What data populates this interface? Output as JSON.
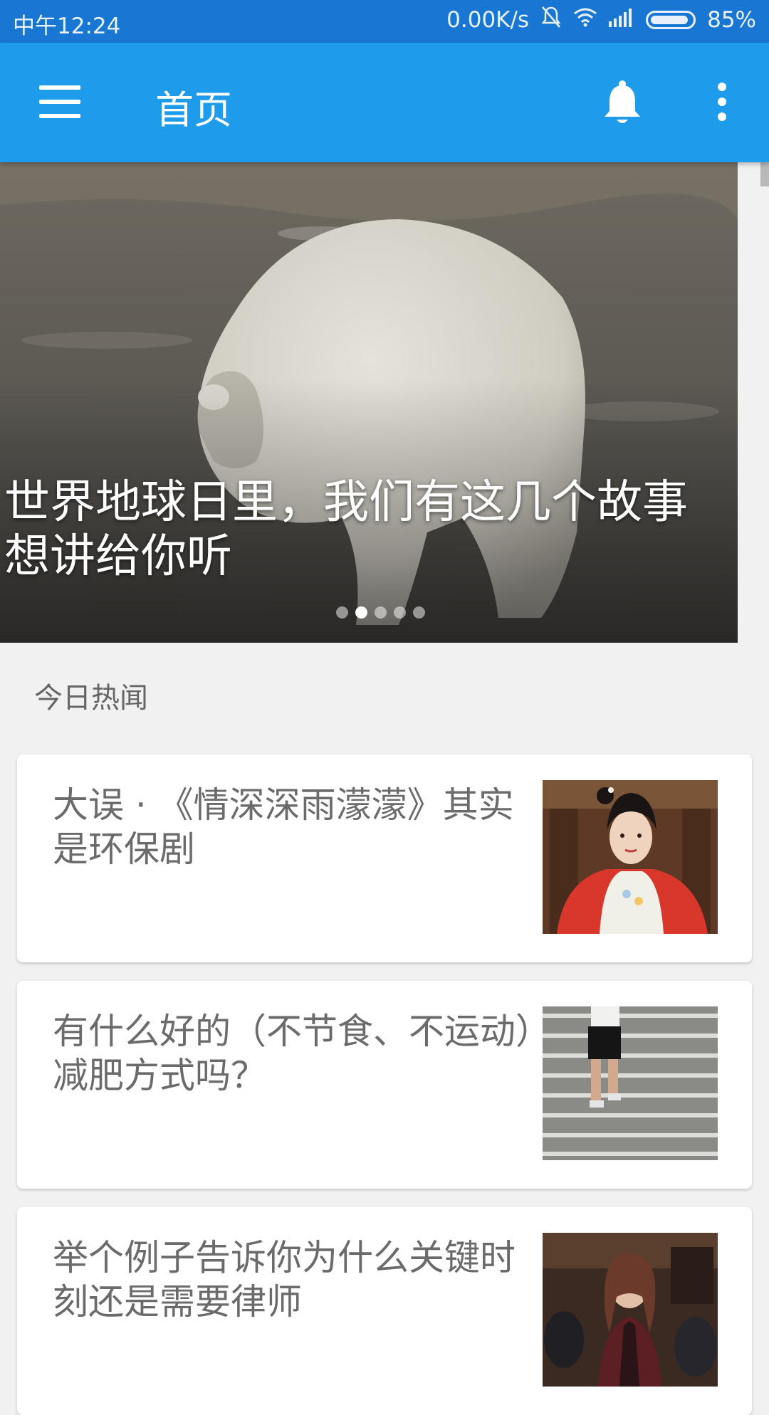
{
  "status_bar": {
    "time": "中午12:24",
    "network_speed": "0.00K/s",
    "battery": "85%",
    "icons": [
      "mute-bell-icon",
      "wifi-icon",
      "signal-icon",
      "battery-icon"
    ]
  },
  "app_bar": {
    "title": "首页",
    "icons": [
      "menu-icon",
      "notification-bell-icon",
      "overflow-menu-icon"
    ],
    "color": "#1e9ceb"
  },
  "hero": {
    "headline": "世界地球日里，我们有这几个故事想讲给你听",
    "image": "polar-bear-photo",
    "page_count": 5,
    "active_page": 2
  },
  "section": {
    "title": "今日热闻"
  },
  "stories": [
    {
      "title": "大误 · 《情深深雨濛濛》其实是环保剧",
      "image": "woman-in-qipao-photo"
    },
    {
      "title": "有什么好的（不节食、不运动）减肥方式吗？",
      "image": "runner-on-stairs-photo"
    },
    {
      "title": "举个例子告诉你为什么关键时刻还是需要律师",
      "image": "courtroom-photo"
    }
  ]
}
